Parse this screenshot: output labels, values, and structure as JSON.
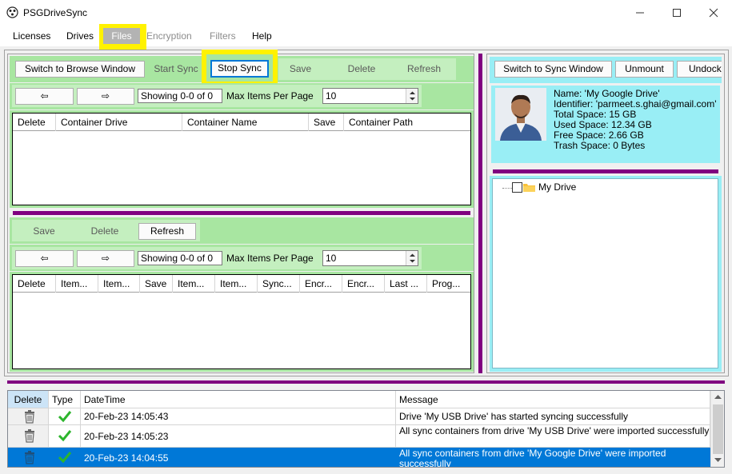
{
  "window": {
    "title": "PSGDriveSync"
  },
  "menu": [
    {
      "label": "Licenses",
      "enabled": true
    },
    {
      "label": "Drives",
      "enabled": true
    },
    {
      "label": "Files",
      "enabled": true
    },
    {
      "label": "Encryption",
      "enabled": false
    },
    {
      "label": "Filters",
      "enabled": false
    },
    {
      "label": "Help",
      "enabled": true
    }
  ],
  "sync_toolbar": {
    "switch_browse": "Switch to Browse Window",
    "start_sync": "Start Sync",
    "stop_sync": "Stop Sync",
    "save": "Save",
    "delete": "Delete",
    "refresh": "Refresh"
  },
  "pager_top": {
    "prev": "⇦",
    "next": "⇨",
    "showing": "Showing 0-0 of 0",
    "max_label": "Max Items Per Page",
    "max_value": "10"
  },
  "containers_grid": {
    "columns": [
      "Delete",
      "Container Drive",
      "Container Name",
      "Save",
      "Container Path"
    ]
  },
  "items_toolbar": {
    "save": "Save",
    "delete": "Delete",
    "refresh": "Refresh"
  },
  "pager_bottom": {
    "prev": "⇦",
    "next": "⇨",
    "showing": "Showing 0-0 of 0",
    "max_label": "Max Items Per Page",
    "max_value": "10"
  },
  "items_grid": {
    "columns": [
      "Delete",
      "Item...",
      "Item...",
      "Save",
      "Item...",
      "Item...",
      "Sync...",
      "Encr...",
      "Encr...",
      "Last ...",
      "Prog..."
    ]
  },
  "drive_toolbar": {
    "switch_sync": "Switch to Sync Window",
    "unmount": "Unmount",
    "undock": "Undock"
  },
  "drive_info": {
    "name": "Name: 'My Google Drive'",
    "identifier": "Identifier: 'parmeet.s.ghai@gmail.com'",
    "total": "Total Space: 15 GB",
    "used": "Used Space: 12.34 GB",
    "free": "Free Space: 2.66 GB",
    "trash": "Trash Space: 0 Bytes"
  },
  "tree": {
    "root": "My Drive"
  },
  "log": {
    "columns": [
      "Delete",
      "Type",
      "DateTime",
      "Message"
    ],
    "rows": [
      {
        "datetime": "20-Feb-23 14:05:43",
        "message": "Drive 'My USB Drive' has started syncing successfully",
        "selected": false
      },
      {
        "datetime": "20-Feb-23 14:05:23",
        "message": "All sync containers from drive 'My USB Drive' were imported successfully",
        "selected": false
      },
      {
        "datetime": "20-Feb-23 14:04:55",
        "message": "All sync containers from drive 'My Google Drive' were imported successfully",
        "selected": true
      }
    ]
  },
  "colors": {
    "panel_green": "#a8e6a1",
    "divider_purple": "#800080",
    "info_cyan": "#99eef5",
    "highlight_yellow": "#fff200",
    "selection_blue": "#0078d7",
    "check_green": "#2db52d"
  },
  "icons": [
    "app-icon",
    "minimize-icon",
    "maximize-icon",
    "close-icon",
    "prev-arrow-icon",
    "next-arrow-icon",
    "spinner-up-icon",
    "spinner-down-icon",
    "checkbox-icon",
    "folder-icon",
    "trash-icon",
    "check-icon",
    "scroll-up-icon",
    "scroll-down-icon"
  ]
}
